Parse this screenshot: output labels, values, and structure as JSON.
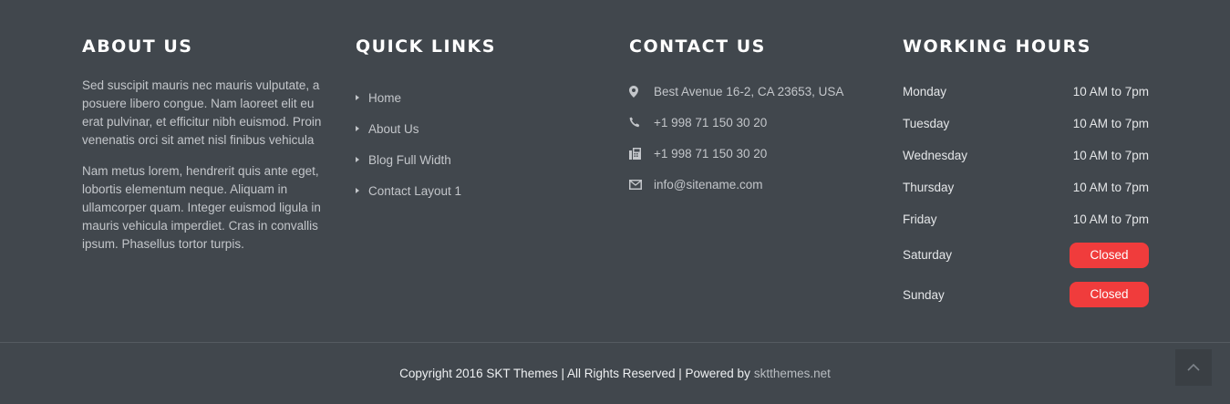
{
  "about": {
    "title": "ABOUT US",
    "paragraph1": "Sed suscipit mauris nec mauris vulputate, a posuere libero congue. Nam laoreet elit eu erat pulvinar, et efficitur nibh euismod. Proin venenatis orci sit amet nisl finibus vehicula",
    "paragraph2": "Nam metus lorem, hendrerit quis ante eget, lobortis elementum neque. Aliquam in ullamcorper quam. Integer euismod ligula in mauris vehicula imperdiet. Cras in convallis ipsum. Phasellus tortor turpis."
  },
  "quick_links": {
    "title": "QUICK LINKS",
    "items": [
      "Home",
      "About Us",
      "Blog Full Width",
      "Contact Layout 1"
    ]
  },
  "contact": {
    "title": "CONTACT US",
    "items": [
      {
        "icon": "map-marker-icon",
        "text": "Best Avenue 16-2, CA 23653, USA"
      },
      {
        "icon": "phone-icon",
        "text": "+1 998 71 150 30 20"
      },
      {
        "icon": "fax-icon",
        "text": "+1 998 71 150 30 20"
      },
      {
        "icon": "envelope-icon",
        "text": "info@sitename.com"
      }
    ]
  },
  "hours": {
    "title": "WORKING HOURS",
    "rows": [
      {
        "day": "Monday",
        "time": "10 AM to 7pm"
      },
      {
        "day": "Tuesday",
        "time": "10 AM to 7pm"
      },
      {
        "day": "Wednesday",
        "time": "10 AM to 7pm"
      },
      {
        "day": "Thursday",
        "time": "10 AM to 7pm"
      },
      {
        "day": "Friday",
        "time": "10 AM to 7pm"
      },
      {
        "day": "Saturday",
        "time": "Closed"
      },
      {
        "day": "Sunday",
        "time": "Closed"
      }
    ]
  },
  "copyright": {
    "text": "Copyright 2016 SKT Themes | All Rights Reserved | Powered by",
    "link": "sktthemes.net"
  },
  "scroll_top": {
    "icon": "chevron-up-icon"
  },
  "colors": {
    "background": "#41474d",
    "closed_badge": "#f03c3c",
    "heading": "#ffffff"
  }
}
